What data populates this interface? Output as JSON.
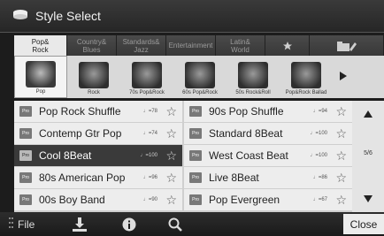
{
  "window": {
    "title": "Style Select",
    "icon": "style-icon"
  },
  "tabs": [
    {
      "label": "Pop&\nRock",
      "active": true
    },
    {
      "label": "Country&\nBlues",
      "active": false
    },
    {
      "label": "Standards&\nJazz",
      "active": false
    },
    {
      "label": "Entertainment",
      "active": false
    },
    {
      "label": "Latin&\nWorld",
      "active": false
    },
    {
      "icon": "star-icon",
      "active": false
    },
    {
      "icon": "user-folder-icon",
      "active": false
    }
  ],
  "subcategories": [
    {
      "label": "Pop",
      "active": true
    },
    {
      "label": "Rock",
      "active": false
    },
    {
      "label": "70s Pop&Rock",
      "active": false
    },
    {
      "label": "60s Pop&Rock",
      "active": false
    },
    {
      "label": "50s Rock&Roll",
      "active": false
    },
    {
      "label": "Pop&Rock Ballad",
      "active": false
    }
  ],
  "styles_left": [
    {
      "badge": "Pro",
      "name": "Pop Rock Shuffle",
      "tempo": "♩=78",
      "selected": false
    },
    {
      "badge": "Pro",
      "name": "Contemp Gtr Pop",
      "tempo": "♩=74",
      "selected": false
    },
    {
      "badge": "Pro",
      "name": "Cool 8Beat",
      "tempo": "♩=100",
      "selected": true
    },
    {
      "badge": "Pro",
      "name": "80s American Pop",
      "tempo": "♩=96",
      "selected": false
    },
    {
      "badge": "Pro",
      "name": "00s Boy Band",
      "tempo": "♩=90",
      "selected": false
    }
  ],
  "styles_right": [
    {
      "badge": "Pro",
      "name": "90s Pop Shuffle",
      "tempo": "♩=94",
      "selected": false
    },
    {
      "badge": "Pro",
      "name": "Standard 8Beat",
      "tempo": "♩=100",
      "selected": false
    },
    {
      "badge": "Pro",
      "name": "West Coast Beat",
      "tempo": "♩=100",
      "selected": false
    },
    {
      "badge": "Pro",
      "name": "Live 8Beat",
      "tempo": "♩=86",
      "selected": false
    },
    {
      "badge": "Pro",
      "name": "Pop Evergreen",
      "tempo": "♩=67",
      "selected": false
    }
  ],
  "pager": {
    "page": "5/6"
  },
  "bottom": {
    "file_label": "File",
    "close_label": "Close"
  }
}
